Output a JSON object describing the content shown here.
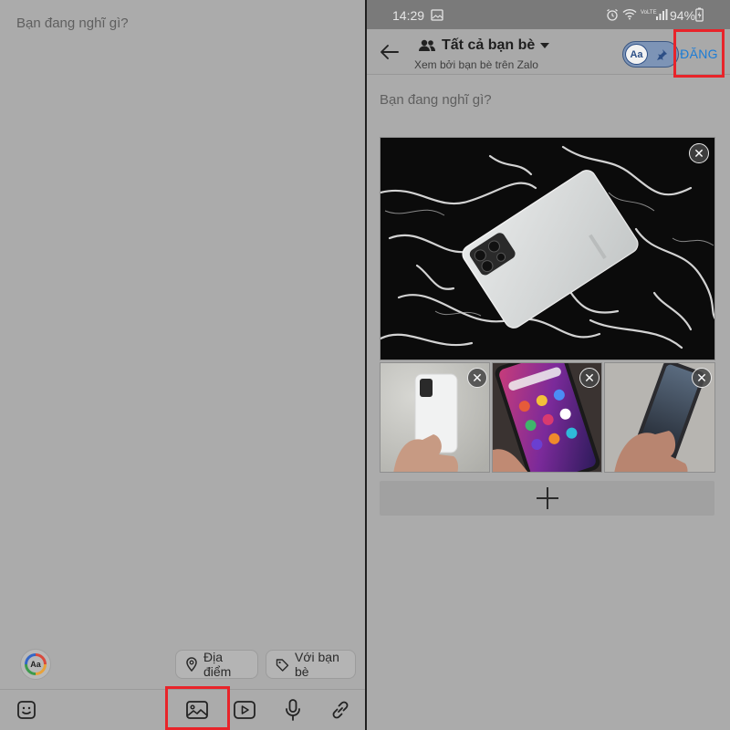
{
  "left": {
    "compose_placeholder": "Bạn đang nghĩ gì?",
    "text_style_button_label": "Aa",
    "chips": {
      "location_label": "Địa điểm",
      "friends_label": "Với bạn bè"
    },
    "toolbar_icons": [
      "sticker-icon",
      "image-icon",
      "video-icon",
      "microphone-icon",
      "link-icon"
    ],
    "highlight_color": "#e8242a"
  },
  "right": {
    "status_time": "14:29",
    "status_battery": "94%",
    "header": {
      "title": "Tất cả bạn bè",
      "subtitle": "Xem bởi bạn bè trên Zalo",
      "toggle_label": "Aa",
      "post_label": "ĐĂNG"
    },
    "compose_placeholder": "Bạn đang nghĩ gì?",
    "photos": [
      {
        "name": "photo-main"
      },
      {
        "name": "photo-hand-white-phone"
      },
      {
        "name": "photo-phone-home-screen"
      },
      {
        "name": "photo-phone-side"
      }
    ],
    "accent_color": "#1b7cd6",
    "highlight_color": "#e8242a"
  }
}
